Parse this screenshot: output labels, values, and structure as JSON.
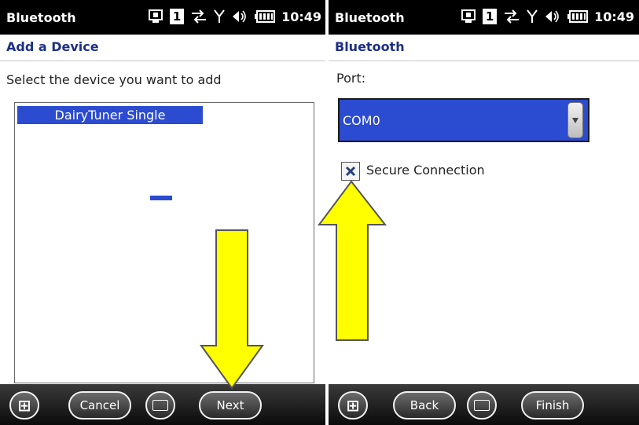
{
  "colors": {
    "accent_blue": "#2b4bd0",
    "header_text": "#1c2f86",
    "arrow_yellow": "#ffff00"
  },
  "status_bar": {
    "title": "Bluetooth",
    "sim_slot": "1",
    "time": "10:49",
    "icons": [
      "phone-icon",
      "sim-icon",
      "data-sync-icon",
      "signal-icon",
      "volume-icon",
      "battery-icon"
    ]
  },
  "screen_left": {
    "header_title": "Add a Device",
    "prompt": "Select the device you want to add",
    "devices": [
      "DairyTuner Single"
    ],
    "selected_device": "DairyTuner Single",
    "bottom_bar": {
      "start_icon": "windows-start-icon",
      "left_button": "Cancel",
      "keyboard_icon": "keyboard-icon",
      "right_button": "Next"
    }
  },
  "screen_right": {
    "header_title": "Bluetooth",
    "port_label": "Port:",
    "port_value": "COM0",
    "secure_connection_label": "Secure Connection",
    "secure_connection_checked": true,
    "bottom_bar": {
      "start_icon": "windows-start-icon",
      "left_button": "Back",
      "keyboard_icon": "keyboard-icon",
      "right_button": "Finish"
    }
  },
  "annotations": [
    {
      "name": "down-arrow-next",
      "color": "#ffff00",
      "points_to": "Next"
    },
    {
      "name": "up-arrow-secure",
      "color": "#ffff00",
      "points_to": "Secure Connection"
    }
  ]
}
